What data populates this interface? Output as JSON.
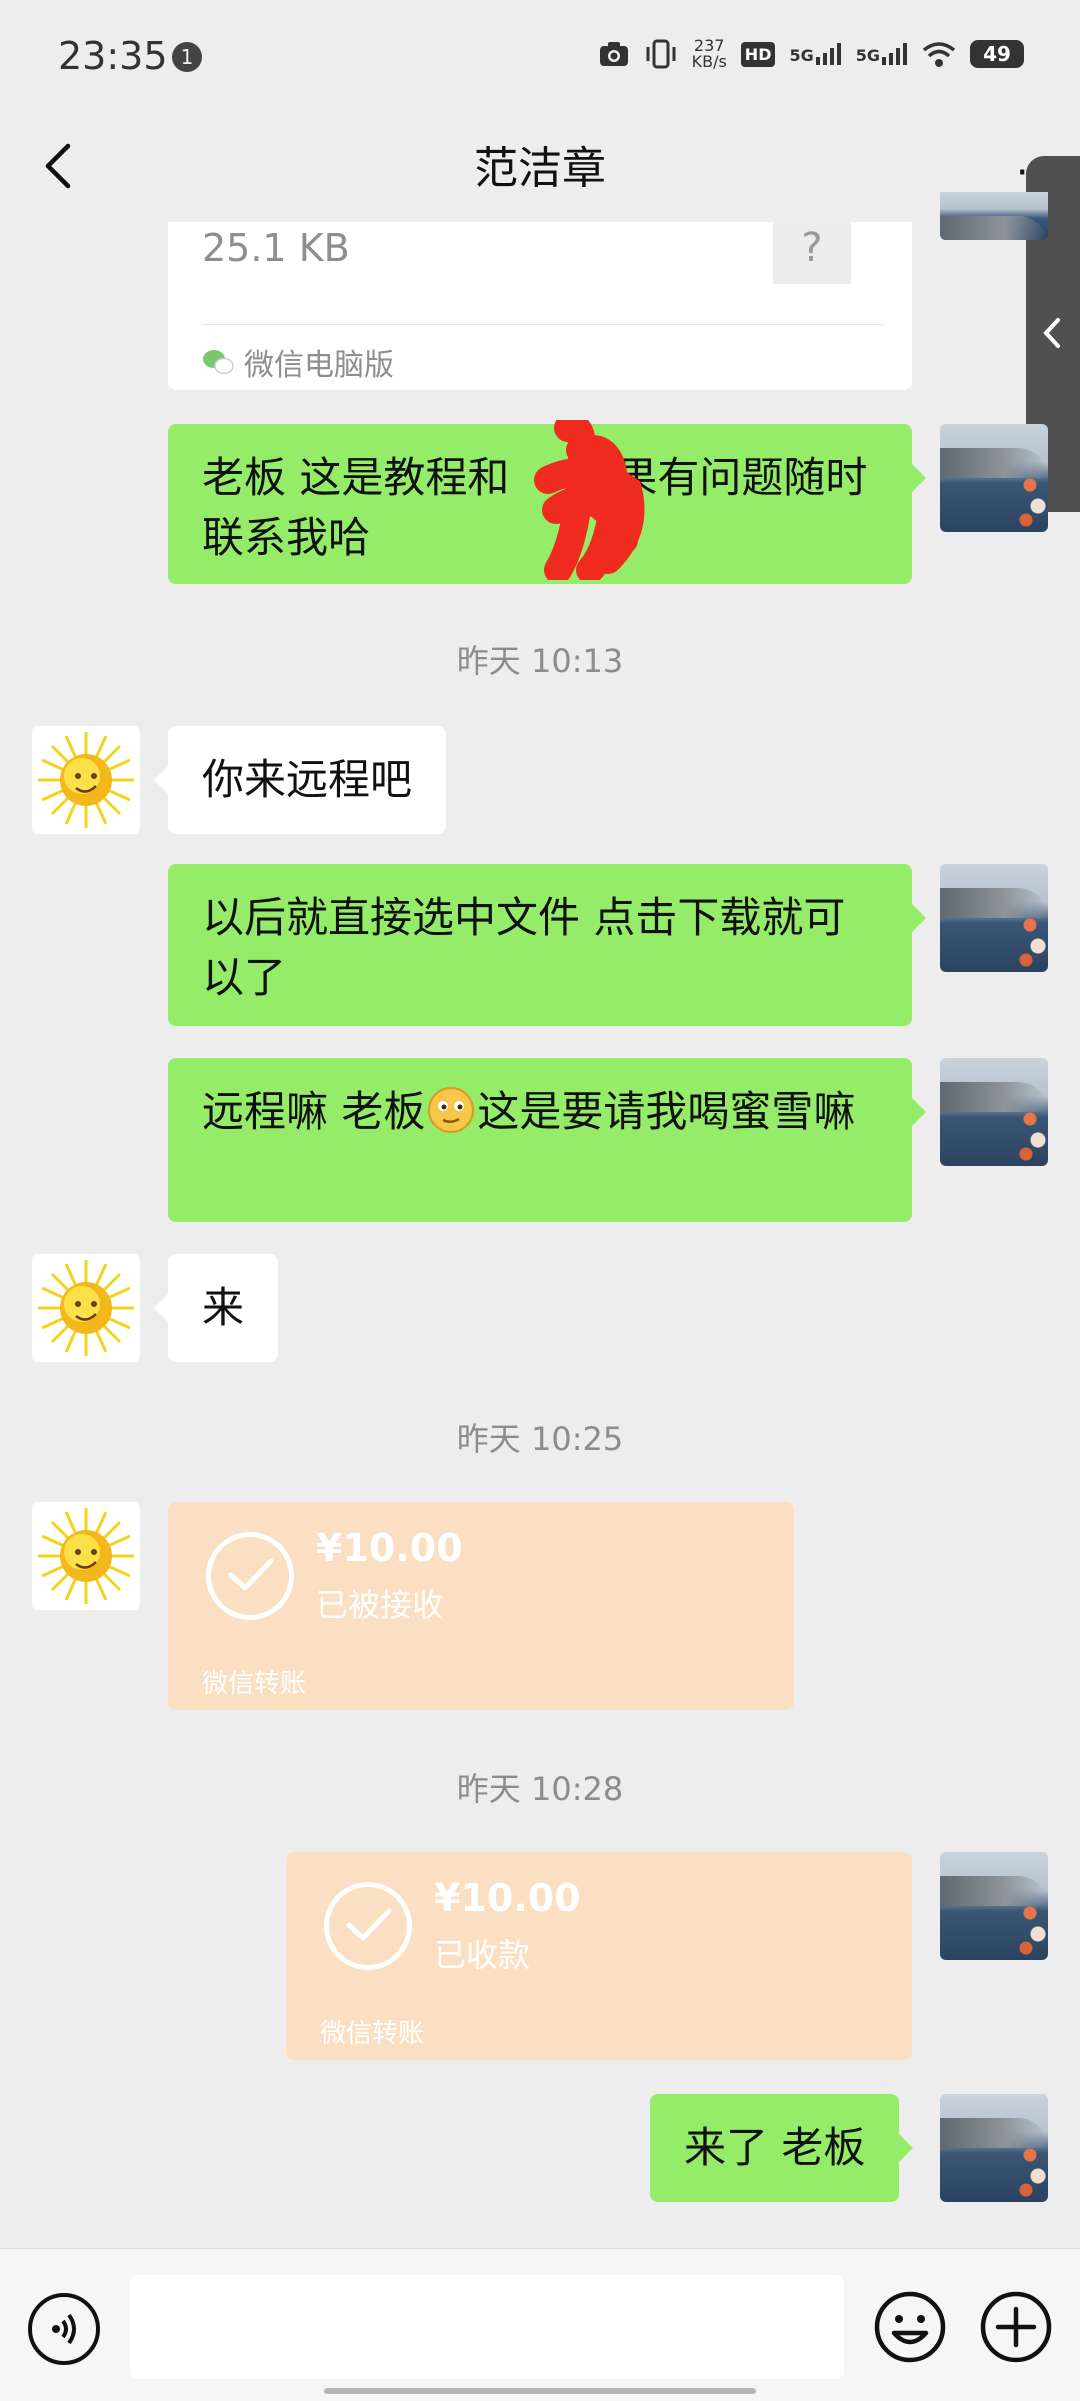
{
  "status_bar": {
    "time": "23:35",
    "notification_count": "1",
    "net_speed_value": "237",
    "net_speed_unit": "KB/s",
    "hd_label": "HD",
    "sim1": "5G",
    "sim2": "5G",
    "battery": "49"
  },
  "header": {
    "title": "范洁章",
    "back_icon": "chevron-left-icon",
    "more_label": "···"
  },
  "messages": {
    "file_card": {
      "size": "25.1 KB",
      "unknown_type": "?",
      "source": "微信电脑版"
    },
    "m1": "老板 这是教程和",
    "m1_after": "如果有问题随时联系我哈",
    "ts1": "昨天 10:13",
    "m2": "你来远程吧",
    "m3": "以后就直接选中文件 点击下载就可以了",
    "m4_part1": "远程嘛 老板",
    "m4_part2": "这是要请我喝蜜雪嘛",
    "m5": "来",
    "ts2": "昨天 10:25",
    "transfer1": {
      "amount": "¥10.00",
      "status": "已被接收",
      "footer": "微信转账"
    },
    "ts3": "昨天 10:28",
    "transfer2": {
      "amount": "¥10.00",
      "status": "已收款",
      "footer": "微信转账"
    },
    "m6": "来了 老板"
  },
  "input_bar": {
    "voice_icon": "voice-icon",
    "emoji_icon": "emoji-icon",
    "plus_icon": "plus-icon"
  },
  "colors": {
    "background": "#ededed",
    "sent_bubble": "#95ec69",
    "received_bubble": "#ffffff",
    "transfer_done": "#fbdfc3"
  }
}
